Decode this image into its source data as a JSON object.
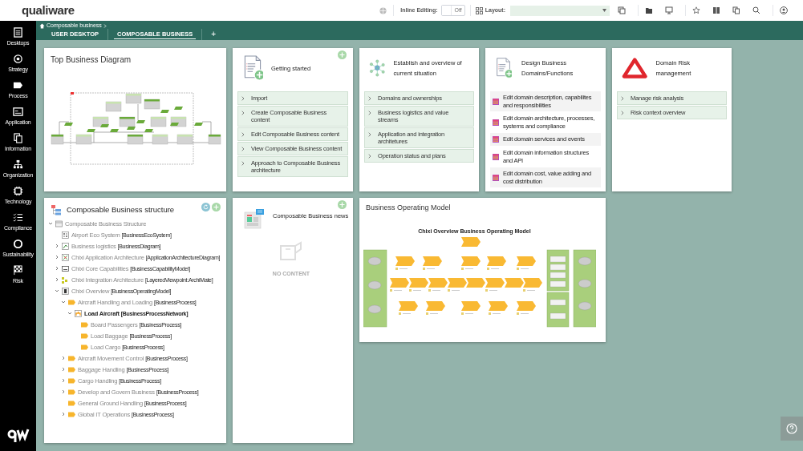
{
  "header": {
    "logo": "qualiware",
    "inline_editing_label": "Inline Editing:",
    "inline_editing": {
      "on": false,
      "label": "Off"
    },
    "layout_label": "Layout:"
  },
  "sidebar": {
    "items": [
      {
        "label": "Desktops",
        "selected": false
      },
      {
        "label": "Strategy",
        "selected": false
      },
      {
        "label": "Process",
        "selected": false
      },
      {
        "label": "Application",
        "selected": false
      },
      {
        "label": "Information",
        "selected": false
      },
      {
        "label": "Organization",
        "selected": false
      },
      {
        "label": "Technology",
        "selected": false
      },
      {
        "label": "Compliance",
        "selected": false
      },
      {
        "label": "Sustainability",
        "selected": false
      },
      {
        "label": "Risk",
        "selected": false
      }
    ]
  },
  "breadcrumb": "Composable business",
  "tabs": [
    {
      "label": "USER DESKTOP",
      "selected": false
    },
    {
      "label": "COMPOSABLE BUSINESS",
      "selected": true
    },
    {
      "label": "+",
      "selected": false
    }
  ],
  "top_diagram": {
    "title": "Top Business Diagram"
  },
  "getting_started": {
    "title": "Getting started",
    "items": [
      "Import",
      "Create Composable Business content",
      "Edit Composable Business content",
      "View Composable Business content",
      "Approach to Composable Business architecture"
    ]
  },
  "establish": {
    "title": "Establish and overview of current situation",
    "items": [
      "Domains and ownerships",
      "Business logistics and value streams",
      "Application and integration architetures",
      "Operation status and plans"
    ]
  },
  "design": {
    "title": "Design Business Domains/Functions",
    "items": [
      "Edit domain description, capabilites and responsibilities",
      "Edit domain architecture, processes, systems and compliance",
      "Edit domain services and events",
      "Edit domain information structures and API",
      "Edit domain cost, value adding and cost distribution"
    ]
  },
  "risk": {
    "title": "Domain Risk management",
    "items": [
      "Manage risk analysis",
      "Risk context overview"
    ]
  },
  "structure": {
    "title": "Composable Business structure",
    "tree": [
      {
        "name": "Composable Business Structure",
        "kind": "structure",
        "expanded": true,
        "selected": false,
        "children": [
          {
            "name": "Airport Eco System",
            "type": "[BusinessEcoSystem]",
            "kind": "ecosystem",
            "selected": false
          },
          {
            "name": "Business logistics",
            "type": "[BusinessDiagram]",
            "kind": "diagram",
            "expanded": false,
            "selected": false
          },
          {
            "name": "Chixi Application Architecture",
            "type": "[ApplicationArchitectureDiagram]",
            "kind": "appdiagram",
            "expanded": false,
            "selected": false
          },
          {
            "name": "Chixi Core Capabilities",
            "type": "[BusinessCapabilityModel]",
            "kind": "capability",
            "expanded": false,
            "selected": false
          },
          {
            "name": "Chixi Integration Architecture",
            "type": "[LayeredViewpoint:ArchiMate]",
            "kind": "layered",
            "expanded": false,
            "selected": false
          },
          {
            "name": "Chixi Overview",
            "type": "[BusinessOperatingModel]",
            "kind": "bom",
            "expanded": true,
            "selected": false,
            "children": [
              {
                "name": "Aircraft Handling and Loading",
                "type": "[BusinessProcess]",
                "kind": "process",
                "expanded": true,
                "selected": false,
                "children": [
                  {
                    "name": "Load Aircraft",
                    "type": "[BusinessProcessNetwork]",
                    "kind": "network",
                    "expanded": true,
                    "selected": true,
                    "children": [
                      {
                        "name": "Board Passengers",
                        "type": "[BusinessProcess]",
                        "kind": "process",
                        "selected": false
                      },
                      {
                        "name": "Load Baggage",
                        "type": "[BusinessProcess]",
                        "kind": "process",
                        "selected": false
                      },
                      {
                        "name": "Load Cargo",
                        "type": "[BusinessProcess]",
                        "kind": "process",
                        "selected": false
                      }
                    ]
                  }
                ]
              },
              {
                "name": "Aircraft Movement Control",
                "type": "[BusinessProcess]",
                "kind": "process",
                "expanded": false,
                "selected": false
              },
              {
                "name": "Baggage Handling",
                "type": "[BusinessProcess]",
                "kind": "process",
                "expanded": false,
                "selected": false
              },
              {
                "name": "Cargo Handling",
                "type": "[BusinessProcess]",
                "kind": "process",
                "expanded": false,
                "selected": false
              },
              {
                "name": "Develop and Govern Business",
                "type": "[BusinessProcess]",
                "kind": "process",
                "expanded": false,
                "selected": false
              },
              {
                "name": "General Ground Handling",
                "type": "[BusinessProcess]",
                "kind": "process",
                "selected": false
              },
              {
                "name": "Global IT Operations",
                "type": "[BusinessProcess]",
                "kind": "process",
                "expanded": false,
                "selected": false
              }
            ]
          }
        ]
      }
    ]
  },
  "news": {
    "title": "Composable Business news",
    "empty_text": "NO CONTENT"
  },
  "operating_model": {
    "title": "Business Operating Model",
    "diagram_title": "Chixi Overview Business Operating Model"
  }
}
